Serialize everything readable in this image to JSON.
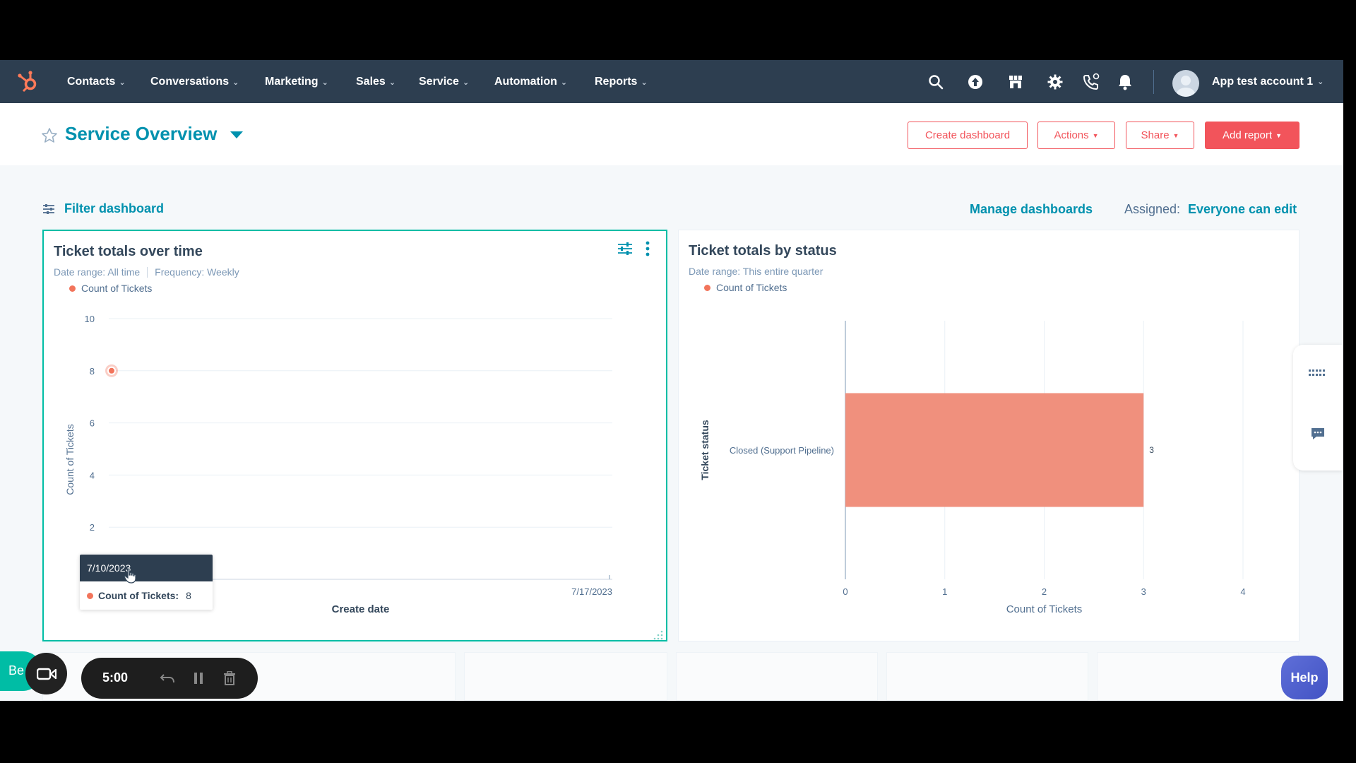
{
  "nav": {
    "items": [
      {
        "label": "Contacts"
      },
      {
        "label": "Conversations"
      },
      {
        "label": "Marketing"
      },
      {
        "label": "Sales"
      },
      {
        "label": "Service"
      },
      {
        "label": "Automation"
      },
      {
        "label": "Reports"
      }
    ],
    "account": "App test account 1",
    "brand_color": "#ff7a59"
  },
  "header": {
    "title": "Service Overview",
    "buttons": {
      "create_dashboard": "Create dashboard",
      "actions": "Actions",
      "share": "Share",
      "add_report": "Add report"
    }
  },
  "toolbar": {
    "filter": "Filter dashboard",
    "manage": "Manage dashboards",
    "assigned_label": "Assigned:",
    "assigned_value": "Everyone can edit"
  },
  "cards": {
    "time": {
      "title": "Ticket totals over time",
      "date_range": "Date range: All time",
      "frequency": "Frequency: Weekly",
      "legend": "Count of Tickets",
      "tooltip_date": "7/10/2023",
      "tooltip_label": "Count of Tickets:",
      "tooltip_value": "8"
    },
    "status": {
      "title": "Ticket totals by status",
      "date_range": "Date range: This entire quarter",
      "legend": "Count of Tickets"
    }
  },
  "chart_data": [
    {
      "type": "line",
      "x": [
        "7/10/2023"
      ],
      "xticks": [
        "7/10/2023",
        "7/17/2023"
      ],
      "series": [
        {
          "name": "Count of Tickets",
          "values": [
            8
          ]
        }
      ],
      "xlabel": "Create date",
      "ylabel": "Count of Tickets",
      "ylim": [
        0,
        10
      ],
      "yticks": [
        0,
        2,
        4,
        6,
        8,
        10
      ],
      "color": "#f2745b"
    },
    {
      "type": "bar",
      "orientation": "horizontal",
      "categories": [
        "Closed (Support Pipeline)"
      ],
      "series": [
        {
          "name": "Count of Tickets",
          "values": [
            3
          ]
        }
      ],
      "data_labels": [
        "3"
      ],
      "xlabel": "Count of Tickets",
      "ylabel": "Ticket status",
      "xlim": [
        0,
        4
      ],
      "xticks": [
        0,
        1,
        2,
        3,
        4
      ],
      "color": "#f0907d"
    }
  ],
  "recorder": {
    "chip": "Be",
    "time": "5:00"
  },
  "help": "Help"
}
